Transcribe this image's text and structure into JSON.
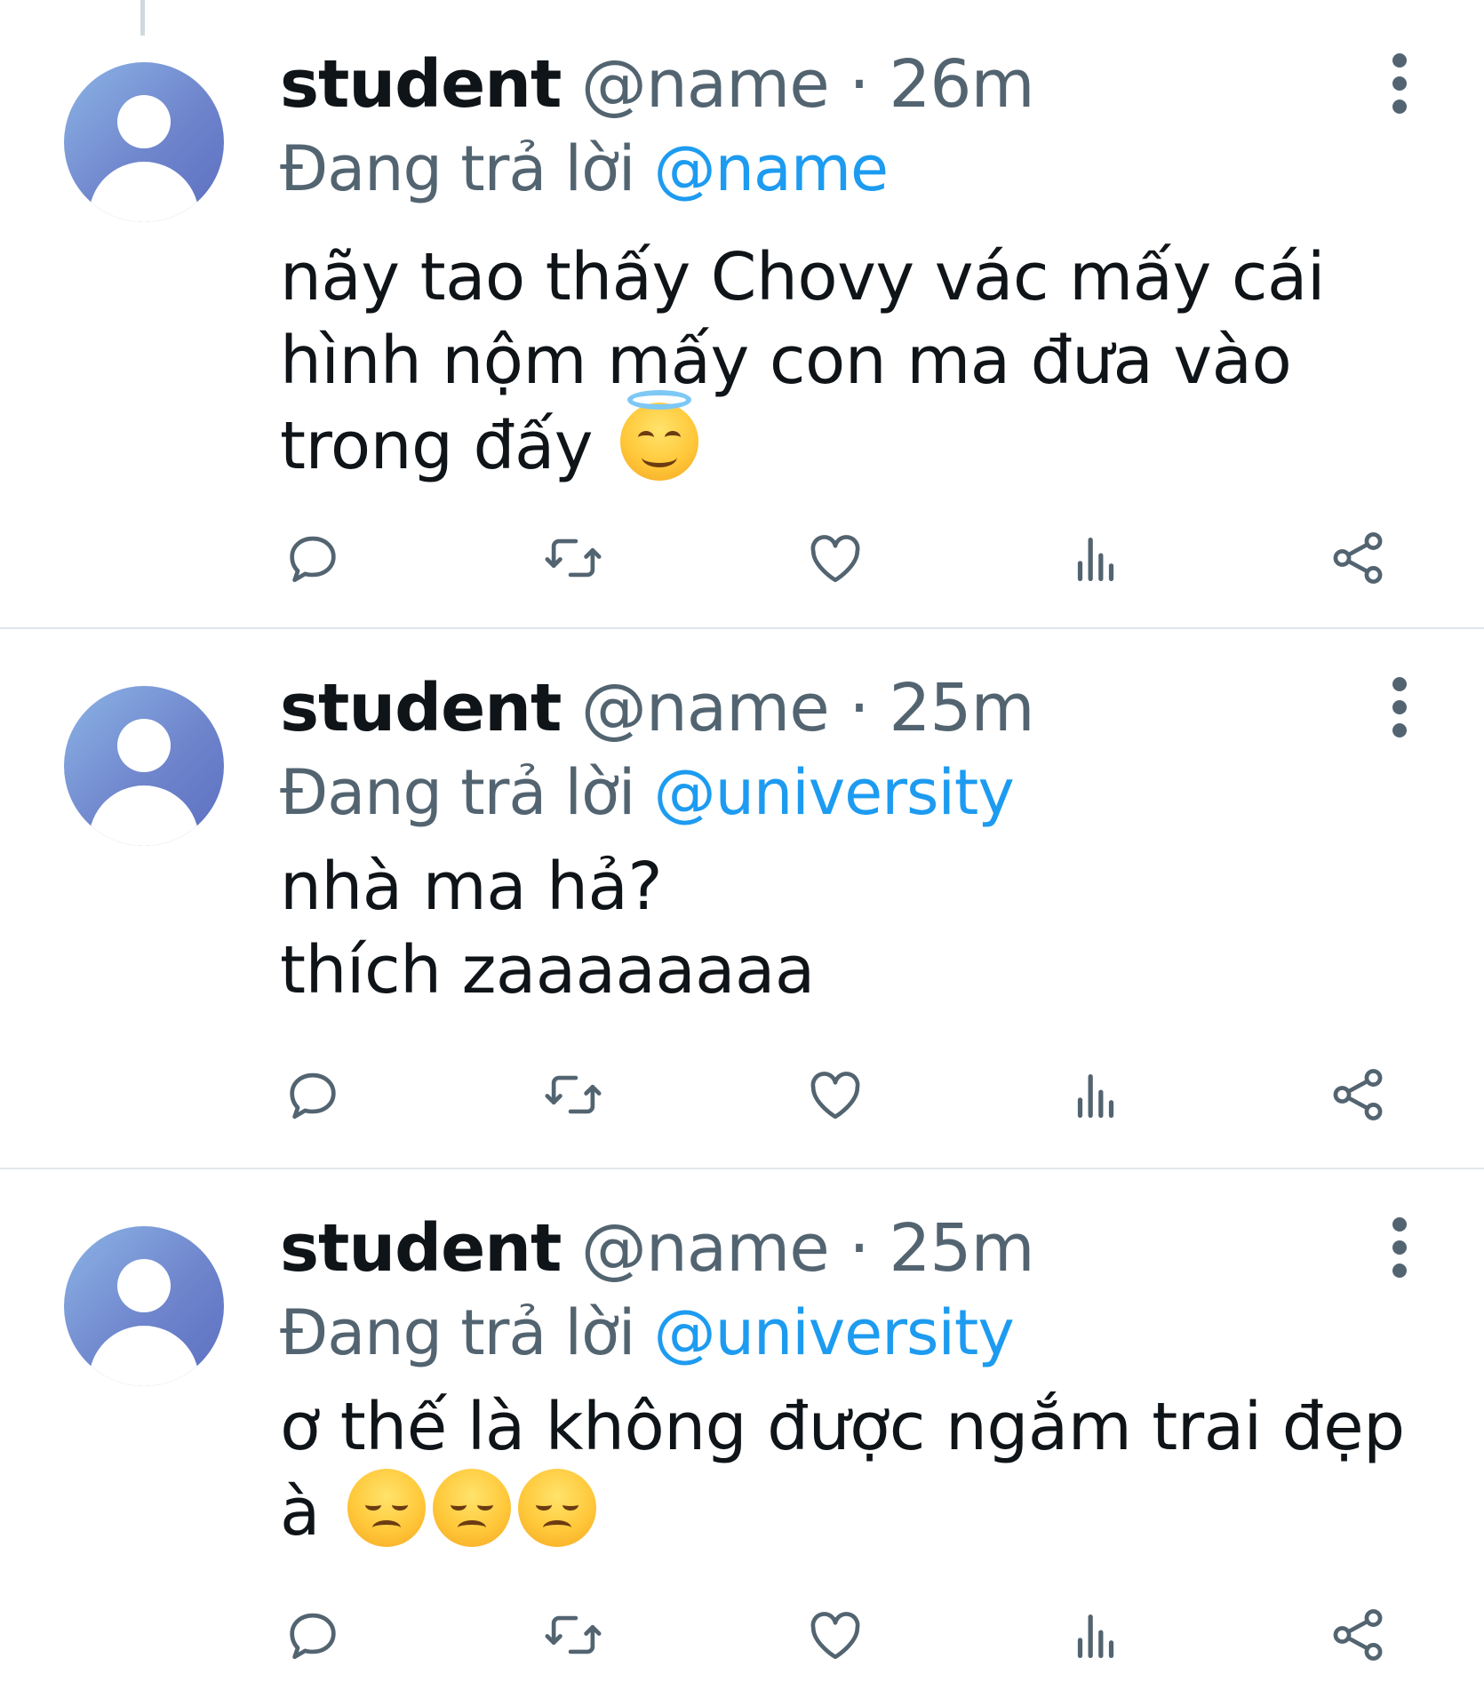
{
  "tweets": [
    {
      "name": "student",
      "handle": "@name",
      "separator": "·",
      "time": "26m",
      "reply_prefix": "Đang trả lời",
      "reply_to": "@name",
      "text_lines": [
        "nãy tao thấy Chovy vác mấy cái",
        "hình nộm mấy con ma đưa vào",
        "trong đấy"
      ],
      "emojis": [
        "smiling-face-with-halo"
      ]
    },
    {
      "name": "student",
      "handle": "@name",
      "separator": "·",
      "time": "25m",
      "reply_prefix": "Đang trả lời",
      "reply_to": "@university",
      "text_lines": [
        "nhà ma hả?",
        "thích zaaaaaaaa"
      ],
      "emojis": []
    },
    {
      "name": "student",
      "handle": "@name",
      "separator": "·",
      "time": "25m",
      "reply_prefix": "Đang trả lời",
      "reply_to": "@university",
      "text_lines": [
        "ơ thế là không được ngắm trai đẹp",
        "à"
      ],
      "emojis": [
        "disappointed-face",
        "disappointed-face",
        "disappointed-face"
      ]
    }
  ],
  "actions": {
    "icons": [
      "reply-icon",
      "retweet-icon",
      "like-icon",
      "views-icon",
      "share-icon"
    ]
  },
  "colors": {
    "text": "#0f1419",
    "secondary": "#536471",
    "link": "#1d9bf0",
    "divider": "#e1e6ea"
  }
}
